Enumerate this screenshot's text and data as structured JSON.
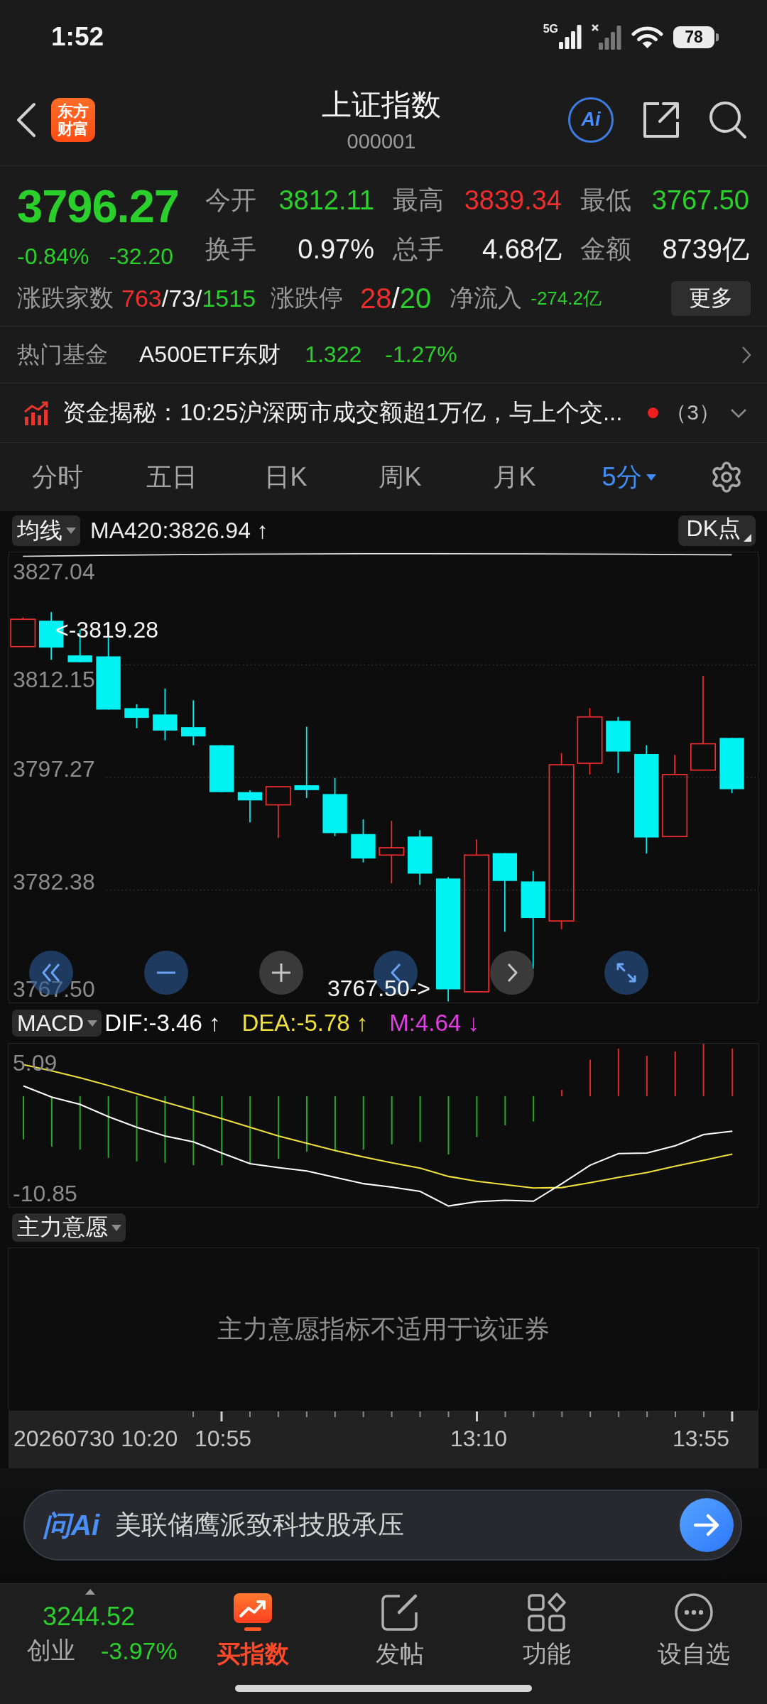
{
  "status_bar": {
    "time": "1:52",
    "network": "5G",
    "battery": "78"
  },
  "header": {
    "logo": "东方财富",
    "title": "上证指数",
    "code": "000001",
    "ai_button": "Ai"
  },
  "quote": {
    "price": "3796.27",
    "change_percent": "-0.84%",
    "change": "-32.20",
    "color": "#2bcf2b",
    "stats": [
      {
        "label": "今开",
        "value": "3812.11",
        "color": "#2bcf2b"
      },
      {
        "label": "最高",
        "value": "3839.34",
        "color": "#ef2d2d"
      },
      {
        "label": "最低",
        "value": "3767.50",
        "color": "#2bcf2b"
      },
      {
        "label": "换手",
        "value": "0.97%",
        "color": "#f2f2f2"
      },
      {
        "label": "总手",
        "value": "4.68亿",
        "color": "#f2f2f2"
      },
      {
        "label": "金额",
        "value": "8739亿",
        "color": "#f2f2f2"
      }
    ],
    "breadth": {
      "label": "涨跌家数",
      "parts": [
        {
          "text": "763",
          "color": "#ef2d2d"
        },
        {
          "text": "/73/",
          "color": "#f2f2f2"
        },
        {
          "text": "1515",
          "color": "#2bcf2b"
        }
      ]
    },
    "limits": {
      "label": "涨跌停",
      "parts": [
        {
          "text": "28",
          "color": "#ef2d2d"
        },
        {
          "text": "/",
          "color": "#f2f2f2"
        },
        {
          "text": "20",
          "color": "#2bcf2b"
        }
      ]
    },
    "net_inflow": {
      "label": "净流入",
      "value": "-274.2亿",
      "color": "#2bcf2b"
    },
    "more_button": "更多"
  },
  "hot_fund": {
    "label": "热门基金",
    "name": "A500ETF东财",
    "price": "1.322",
    "change": "-1.27%",
    "color": "#2bcf2b"
  },
  "news": {
    "text": "资金揭秘：10:25沪深两市成交额超1万亿，与上个交...",
    "unread": true,
    "count": "（3）"
  },
  "chart_tabs": [
    {
      "label": "分时",
      "kind": "tab",
      "selected": false
    },
    {
      "label": "五日",
      "kind": "tab",
      "selected": false
    },
    {
      "label": "日K",
      "kind": "tab",
      "selected": false
    },
    {
      "label": "周K",
      "kind": "tab",
      "selected": false
    },
    {
      "label": "月K",
      "kind": "tab",
      "selected": false
    },
    {
      "label": "5分",
      "kind": "menu",
      "selected": true
    }
  ],
  "kline": {
    "indicator": "均线",
    "ma_value": "MA420:3826.94 ↑",
    "dk_button": "DK点",
    "y_labels": [
      "3827.04",
      "3812.15",
      "3797.27",
      "3782.38",
      "3767.50"
    ],
    "high_marker": "<-3819.28",
    "low_marker": "3767.50->"
  },
  "macd": {
    "indicator": "MACD",
    "values": [
      {
        "text": "DIF:-3.46 ↑",
        "color": "#ffffff"
      },
      {
        "text": "DEA:-5.78 ↑",
        "color": "#f0e03c"
      },
      {
        "text": "M:4.64 ↓",
        "color": "#e23fe2"
      }
    ],
    "y_labels": [
      "5.09",
      "-10.85"
    ]
  },
  "main_intent": {
    "indicator": "主力意愿",
    "message": "主力意愿指标不适用于该证券"
  },
  "time_axis": [
    "20260730 10:20",
    "10:55",
    "13:10",
    "13:55"
  ],
  "ai_bar": {
    "logo": "问Ai",
    "placeholder": "美联储鹰派致科技股承压"
  },
  "bottom_bar": {
    "index": {
      "value": "3244.52",
      "name": "创业",
      "change": "-3.97%",
      "color": "#2bcf2b"
    },
    "actions": [
      {
        "label": "买指数",
        "kind": "promo"
      },
      {
        "label": "发帖",
        "kind": "post"
      },
      {
        "label": "功能",
        "kind": "functions"
      },
      {
        "label": "设自选",
        "kind": "watchlist"
      }
    ]
  }
}
